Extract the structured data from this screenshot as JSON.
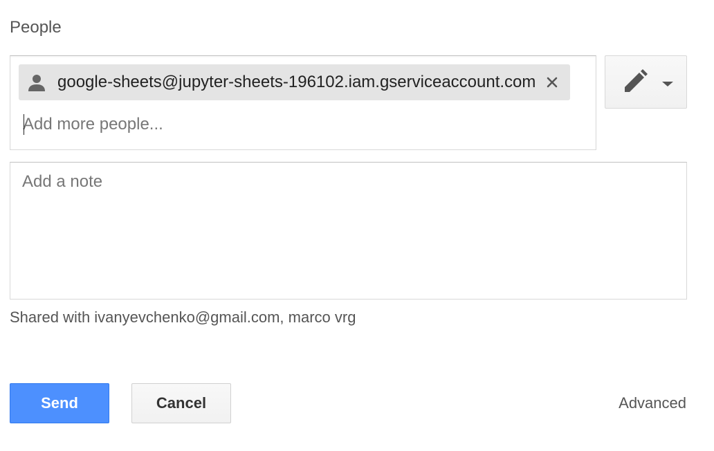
{
  "section": {
    "title": "People"
  },
  "people_input": {
    "chips": [
      {
        "email": "google-sheets@jupyter-sheets-196102.iam.gserviceaccount.com",
        "icon": "person-icon"
      }
    ],
    "placeholder": "Add more people...",
    "value": ""
  },
  "permission": {
    "icon": "pencil-icon",
    "dropdown_icon": "chevron-down-icon"
  },
  "note": {
    "placeholder": "Add a note",
    "value": ""
  },
  "shared_with": {
    "text": "Shared with ivanyevchenko@gmail.com, marco vrg"
  },
  "actions": {
    "send_label": "Send",
    "cancel_label": "Cancel",
    "advanced_label": "Advanced"
  },
  "colors": {
    "primary": "#4d90fe",
    "chip_bg": "#e4e4e4",
    "text_muted": "#555555"
  }
}
